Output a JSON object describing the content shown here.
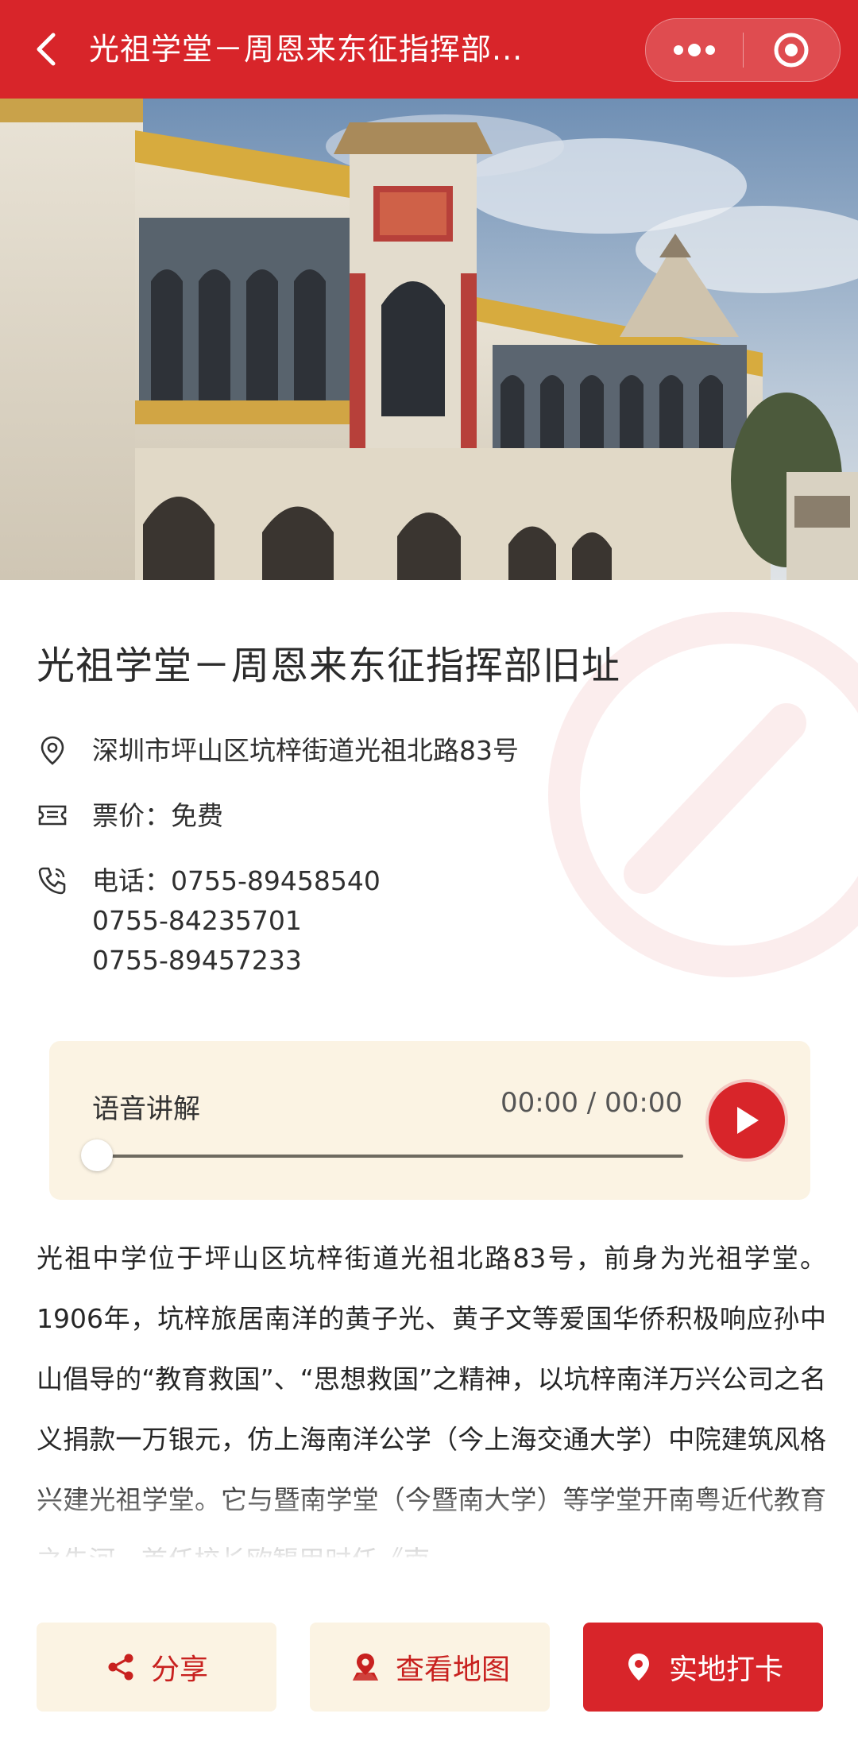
{
  "header": {
    "title": "光祖学堂－周恩来东征指挥部...",
    "theme_color": "#d8252a"
  },
  "hero": {
    "image_alt": "building-photo"
  },
  "site": {
    "name": "光祖学堂－周恩来东征指挥部旧址",
    "address": "深圳市坪山区坑梓街道光祖北路83号",
    "ticket": "票价：免费",
    "phone_label": "电话：",
    "phones": [
      "0755-89458540",
      "0755-84235701",
      "0755-89457233"
    ]
  },
  "audio": {
    "title": "语音讲解",
    "time": "00:00 / 00:00",
    "progress": 0
  },
  "description": "光祖中学位于坪山区坑梓街道光祖北路83号，前身为光祖学堂。1906年，坑梓旅居南洋的黄子光、黄子文等爱国华侨积极响应孙中山倡导的“教育救国”、“思想救国”之精神，以坑梓南洋万兴公司之名义捐款一万银元，仿上海南洋公学（今上海交通大学）中院建筑风格兴建光祖学堂。它与暨南学堂（今暨南大学）等学堂开南粤近代教育之先河。首任校长欧榘甲时任《南",
  "actions": {
    "share": "分享",
    "map": "查看地图",
    "checkin": "实地打卡"
  }
}
